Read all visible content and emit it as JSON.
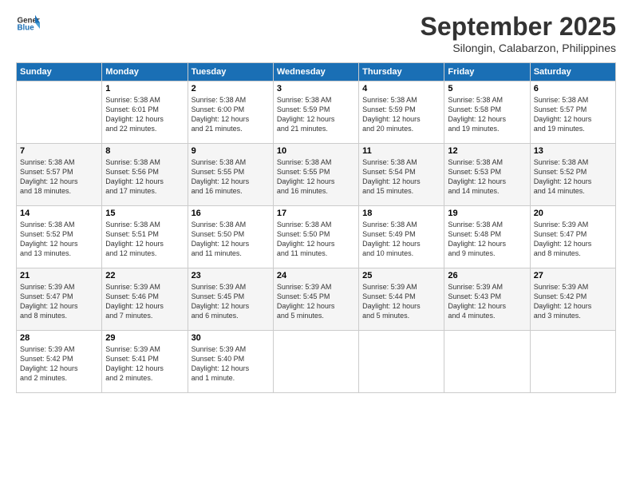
{
  "header": {
    "logo_line1": "General",
    "logo_line2": "Blue",
    "title": "September 2025",
    "subtitle": "Silongin, Calabarzon, Philippines"
  },
  "columns": [
    "Sunday",
    "Monday",
    "Tuesday",
    "Wednesday",
    "Thursday",
    "Friday",
    "Saturday"
  ],
  "weeks": [
    [
      {
        "day": "",
        "info": ""
      },
      {
        "day": "1",
        "info": "Sunrise: 5:38 AM\nSunset: 6:01 PM\nDaylight: 12 hours\nand 22 minutes."
      },
      {
        "day": "2",
        "info": "Sunrise: 5:38 AM\nSunset: 6:00 PM\nDaylight: 12 hours\nand 21 minutes."
      },
      {
        "day": "3",
        "info": "Sunrise: 5:38 AM\nSunset: 5:59 PM\nDaylight: 12 hours\nand 21 minutes."
      },
      {
        "day": "4",
        "info": "Sunrise: 5:38 AM\nSunset: 5:59 PM\nDaylight: 12 hours\nand 20 minutes."
      },
      {
        "day": "5",
        "info": "Sunrise: 5:38 AM\nSunset: 5:58 PM\nDaylight: 12 hours\nand 19 minutes."
      },
      {
        "day": "6",
        "info": "Sunrise: 5:38 AM\nSunset: 5:57 PM\nDaylight: 12 hours\nand 19 minutes."
      }
    ],
    [
      {
        "day": "7",
        "info": "Sunrise: 5:38 AM\nSunset: 5:57 PM\nDaylight: 12 hours\nand 18 minutes."
      },
      {
        "day": "8",
        "info": "Sunrise: 5:38 AM\nSunset: 5:56 PM\nDaylight: 12 hours\nand 17 minutes."
      },
      {
        "day": "9",
        "info": "Sunrise: 5:38 AM\nSunset: 5:55 PM\nDaylight: 12 hours\nand 16 minutes."
      },
      {
        "day": "10",
        "info": "Sunrise: 5:38 AM\nSunset: 5:55 PM\nDaylight: 12 hours\nand 16 minutes."
      },
      {
        "day": "11",
        "info": "Sunrise: 5:38 AM\nSunset: 5:54 PM\nDaylight: 12 hours\nand 15 minutes."
      },
      {
        "day": "12",
        "info": "Sunrise: 5:38 AM\nSunset: 5:53 PM\nDaylight: 12 hours\nand 14 minutes."
      },
      {
        "day": "13",
        "info": "Sunrise: 5:38 AM\nSunset: 5:52 PM\nDaylight: 12 hours\nand 14 minutes."
      }
    ],
    [
      {
        "day": "14",
        "info": "Sunrise: 5:38 AM\nSunset: 5:52 PM\nDaylight: 12 hours\nand 13 minutes."
      },
      {
        "day": "15",
        "info": "Sunrise: 5:38 AM\nSunset: 5:51 PM\nDaylight: 12 hours\nand 12 minutes."
      },
      {
        "day": "16",
        "info": "Sunrise: 5:38 AM\nSunset: 5:50 PM\nDaylight: 12 hours\nand 11 minutes."
      },
      {
        "day": "17",
        "info": "Sunrise: 5:38 AM\nSunset: 5:50 PM\nDaylight: 12 hours\nand 11 minutes."
      },
      {
        "day": "18",
        "info": "Sunrise: 5:38 AM\nSunset: 5:49 PM\nDaylight: 12 hours\nand 10 minutes."
      },
      {
        "day": "19",
        "info": "Sunrise: 5:38 AM\nSunset: 5:48 PM\nDaylight: 12 hours\nand 9 minutes."
      },
      {
        "day": "20",
        "info": "Sunrise: 5:39 AM\nSunset: 5:47 PM\nDaylight: 12 hours\nand 8 minutes."
      }
    ],
    [
      {
        "day": "21",
        "info": "Sunrise: 5:39 AM\nSunset: 5:47 PM\nDaylight: 12 hours\nand 8 minutes."
      },
      {
        "day": "22",
        "info": "Sunrise: 5:39 AM\nSunset: 5:46 PM\nDaylight: 12 hours\nand 7 minutes."
      },
      {
        "day": "23",
        "info": "Sunrise: 5:39 AM\nSunset: 5:45 PM\nDaylight: 12 hours\nand 6 minutes."
      },
      {
        "day": "24",
        "info": "Sunrise: 5:39 AM\nSunset: 5:45 PM\nDaylight: 12 hours\nand 5 minutes."
      },
      {
        "day": "25",
        "info": "Sunrise: 5:39 AM\nSunset: 5:44 PM\nDaylight: 12 hours\nand 5 minutes."
      },
      {
        "day": "26",
        "info": "Sunrise: 5:39 AM\nSunset: 5:43 PM\nDaylight: 12 hours\nand 4 minutes."
      },
      {
        "day": "27",
        "info": "Sunrise: 5:39 AM\nSunset: 5:42 PM\nDaylight: 12 hours\nand 3 minutes."
      }
    ],
    [
      {
        "day": "28",
        "info": "Sunrise: 5:39 AM\nSunset: 5:42 PM\nDaylight: 12 hours\nand 2 minutes."
      },
      {
        "day": "29",
        "info": "Sunrise: 5:39 AM\nSunset: 5:41 PM\nDaylight: 12 hours\nand 2 minutes."
      },
      {
        "day": "30",
        "info": "Sunrise: 5:39 AM\nSunset: 5:40 PM\nDaylight: 12 hours\nand 1 minute."
      },
      {
        "day": "",
        "info": ""
      },
      {
        "day": "",
        "info": ""
      },
      {
        "day": "",
        "info": ""
      },
      {
        "day": "",
        "info": ""
      }
    ]
  ]
}
